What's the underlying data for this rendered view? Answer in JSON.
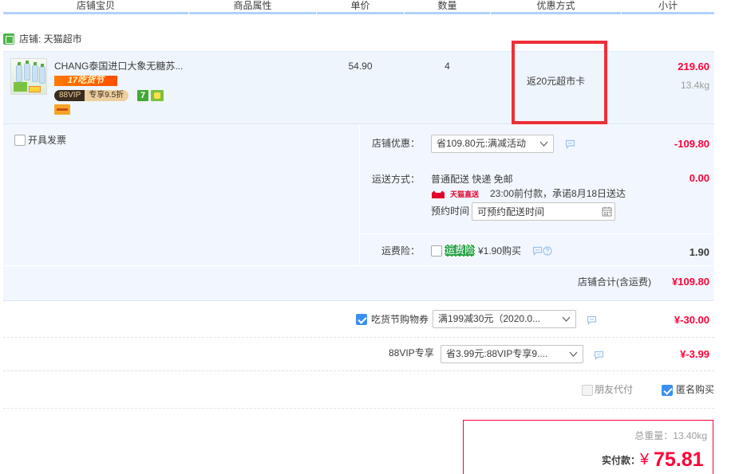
{
  "header": {
    "columns": [
      "店铺宝贝",
      "商品属性",
      "单价",
      "数量",
      "优惠方式",
      "小计"
    ]
  },
  "shop": {
    "label": "店铺: 天猫超市"
  },
  "item": {
    "title": "CHANG泰国进口大象无糖苏...",
    "promo_banner": "17吃货节",
    "vip_badge": "88VIP",
    "vip_discount": "专享9.5折",
    "return_icon_text": "7",
    "price": "54.90",
    "quantity": "4",
    "promotion": "返20元超市卡",
    "subtotal": "219.60",
    "weight": "13.4kg"
  },
  "invoice": {
    "label": "开具发票",
    "checked": false
  },
  "shop_discount": {
    "label": "店铺优惠：",
    "selected": "省109.80元:满减活动",
    "amount": "-109.80"
  },
  "shipping": {
    "label": "运送方式：",
    "method": "普通配送 快递 免邮",
    "amount": "0.00",
    "direct_label": "天猫直送",
    "promise": "23:00前付款，承诺8月18日送达",
    "appointment_label": "预约时间",
    "appointment_placeholder": "可预约配送时间"
  },
  "insurance": {
    "label": "运费险：",
    "checked": false,
    "badge": "运费险",
    "price_text": "¥1.90购买",
    "amount": "1.90"
  },
  "shop_total": {
    "label": "店铺合计(含运费)",
    "amount": "¥109.80"
  },
  "coupon": {
    "checked": true,
    "label": "吃货节购物券",
    "selected": "满199减30元（2020.0...",
    "amount": "¥-30.00"
  },
  "vip": {
    "label": "88VIP专享",
    "selected": "省3.99元:88VIP专享9....",
    "amount": "¥-3.99"
  },
  "options": {
    "friend_pay_label": "朋友代付",
    "friend_pay_checked": false,
    "anonymous_label": "匿名购买",
    "anonymous_checked": true
  },
  "summary": {
    "weight_label": "总重量：",
    "weight": "13.40kg",
    "pay_label": "实付款：",
    "currency": "¥",
    "total": "75.81"
  },
  "icons": {
    "shop": "tmall-supermarket-icon",
    "return": "seven-day-return-icon",
    "guarantee": "guarantee-icon",
    "card": "card-payment-icon",
    "chat": "chat-bubble-icon",
    "help": "help-question-icon",
    "calendar": "calendar-icon",
    "dropdown": "chevron-down-icon",
    "direct": "tmall-direct-logo"
  },
  "colors": {
    "accent_red": "#ff0036",
    "checkbox_blue": "#3d8ff0",
    "section_bg": "#f2f7ff",
    "item_bg": "#eef5fd",
    "header_underline": "#b2d1ff",
    "highlight_box": "#ed2f37",
    "insurance_green": "#2aa24b"
  }
}
